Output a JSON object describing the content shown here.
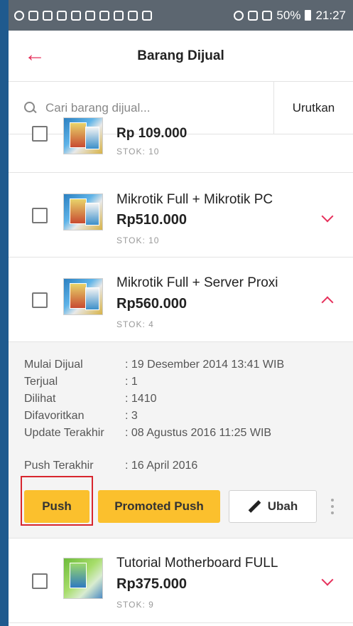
{
  "status_bar": {
    "battery": "50%",
    "time": "21:27"
  },
  "app_bar": {
    "title": "Barang Dijual"
  },
  "search": {
    "placeholder": "Cari barang dijual...",
    "sort_label": "Urutkan"
  },
  "items": [
    {
      "title": "Rp 109.000",
      "stock": "STOK: 10"
    },
    {
      "title": "Mikrotik Full + Mikrotik PC",
      "price": "Rp510.000",
      "stock": "STOK: 10"
    },
    {
      "title": "Mikrotik Full + Server Proxi",
      "price": "Rp560.000",
      "stock": "STOK: 4"
    },
    {
      "title": "Tutorial Motherboard FULL",
      "price": "Rp375.000",
      "stock": "STOK: 9"
    }
  ],
  "details": {
    "rows": [
      {
        "label": "Mulai Dijual",
        "value": ": 19 Desember 2014 13:41 WIB"
      },
      {
        "label": "Terjual",
        "value": ": 1"
      },
      {
        "label": "Dilihat",
        "value": ": 1410"
      },
      {
        "label": "Difavoritkan",
        "value": ": 3"
      },
      {
        "label": "Update Terakhir",
        "value": ": 08 Agustus 2016 11:25 WIB"
      },
      {
        "label": "Push Terakhir",
        "value": ": 16 April 2016"
      }
    ],
    "push_label": "Push",
    "promoted_push_label": "Promoted Push",
    "edit_label": "Ubah"
  },
  "colors": {
    "accent": "#e6305b",
    "button_yellow": "#fbc02d",
    "highlight": "#d8262e"
  }
}
